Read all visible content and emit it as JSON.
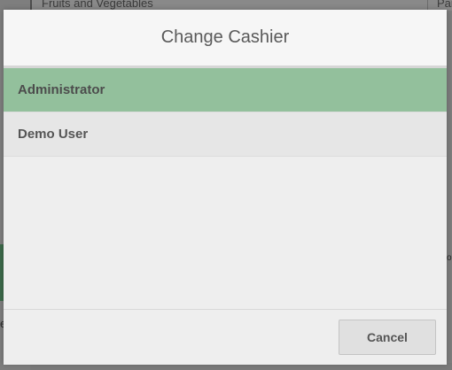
{
  "background": {
    "category_label": "Fruits and Vegetables",
    "right_tab_label": "Par",
    "left_fragment": "e",
    "right_fragment": "o"
  },
  "dialog": {
    "title": "Change Cashier",
    "cashiers": [
      {
        "label": "Administrator",
        "selected": true
      },
      {
        "label": "Demo User",
        "selected": false
      }
    ],
    "cancel_label": "Cancel",
    "colors": {
      "selected_row": "#93c09c",
      "row": "#e6e6e6",
      "panel": "#eeeeee"
    }
  }
}
